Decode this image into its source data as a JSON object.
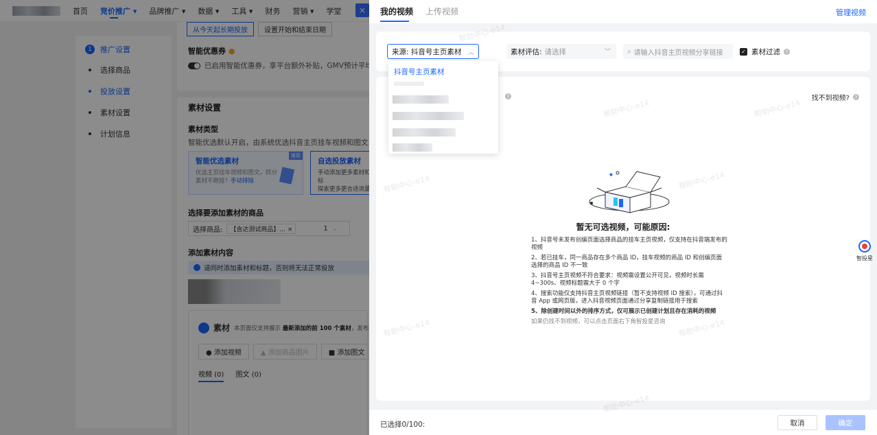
{
  "topnav": {
    "items": [
      "首页",
      "竞价推广 ▾",
      "品牌推广 ▾",
      "数据 ▾",
      "工具 ▾",
      "财务",
      "营销 ▾",
      "学堂"
    ],
    "close": "×"
  },
  "stepper": {
    "steps": [
      "推广设置",
      "选择商品",
      "投放设置",
      "素材设置",
      "计划信息"
    ],
    "first_num": "1"
  },
  "form": {
    "btn1": "从今天起长期投放",
    "btn2": "设置开始和结束日期",
    "coupon_label": "智能优惠券",
    "coupon_text": "已启用智能优惠券，享平台额外补贴，GMV预计平均提升",
    "material_title": "素材设置",
    "material_type": "素材类型",
    "material_desc": "智能优选默认开启，由系统优选抖音主页挂车视频和图文，推荐",
    "card1_title": "智能优选素材",
    "card1_desc1": "优选主页挂车视频和图文，抓分",
    "card1_desc2": "素材不跑投？",
    "card1_link": "手动排除",
    "card1_badge": "推荐",
    "card2_title": "自选投放素材",
    "card2_desc1": "手动添加更多素材和标",
    "card2_desc2": "探索更多更合适流量",
    "goods_label": "选择要添加素材的商品",
    "goods_select": "选择商品:",
    "goods_tag": "【含达测试商品】... ×",
    "goods_count": "1",
    "add_label": "添加素材内容",
    "tip": "请同时添加素材和标题，否则将无法正常投放",
    "box_title": "素材",
    "box_note1": "本页面仅支持展示",
    "box_note_bold": "最新添加的前 100 个素材",
    "box_note2": "，发布后仍",
    "btn_video": "● 添加视频",
    "btn_image": "▲ 添加商品图片",
    "btn_imgtext": "■ 添加图文",
    "tab_video": "视频 (0)",
    "tab_imgtext": "图文 (0)"
  },
  "drawer": {
    "tab_mine": "我的视频",
    "tab_upload": "上传视频",
    "manage": "管理视频",
    "source_label": "来源:",
    "source_value": "抖音号主页素材",
    "eval_label": "素材评估:",
    "eval_placeholder": "请选择",
    "search_placeholder": "请输入抖音主页视频分享链接",
    "filter_label": "素材过滤",
    "help": "找不到视频?",
    "dropdown_selected": "抖音号主页素材",
    "empty_title": "暂无可选视频，可能原因:",
    "reasons": [
      "1、抖音号未发布创编页面选择商品的挂车主页视频，仅支持在抖音端发布的视频",
      "2、若已挂车，同一商品存在多个商品 ID，挂车视频的商品 ID 和创编页面选择的商品 ID 不一致",
      "3、抖音号主页视频不符合要求：视频需设置公开可见，视频时长需 4~300s、视频标题需大于 0 个字",
      "4、搜索功能仅支持抖音主页视频链接（暂不支持视频 ID 搜索），可通过抖音 App 或网页版，进入抖音视频页面通过分享复制链接用于搜索",
      "5、除创建时间以外的排序方式，仅可展示已创建计划且存在消耗的视频"
    ],
    "reason_last": "如果仍找不到视频，可以点击页面右下角智投星咨询",
    "selected_count": "已选择0/100:",
    "cancel": "取消",
    "confirm": "确定",
    "assistant": "智投星",
    "watermark": "帮助中心-e14"
  },
  "colors": {
    "primary": "#1966ff",
    "confirm_disabled": "#a9c3ff"
  }
}
